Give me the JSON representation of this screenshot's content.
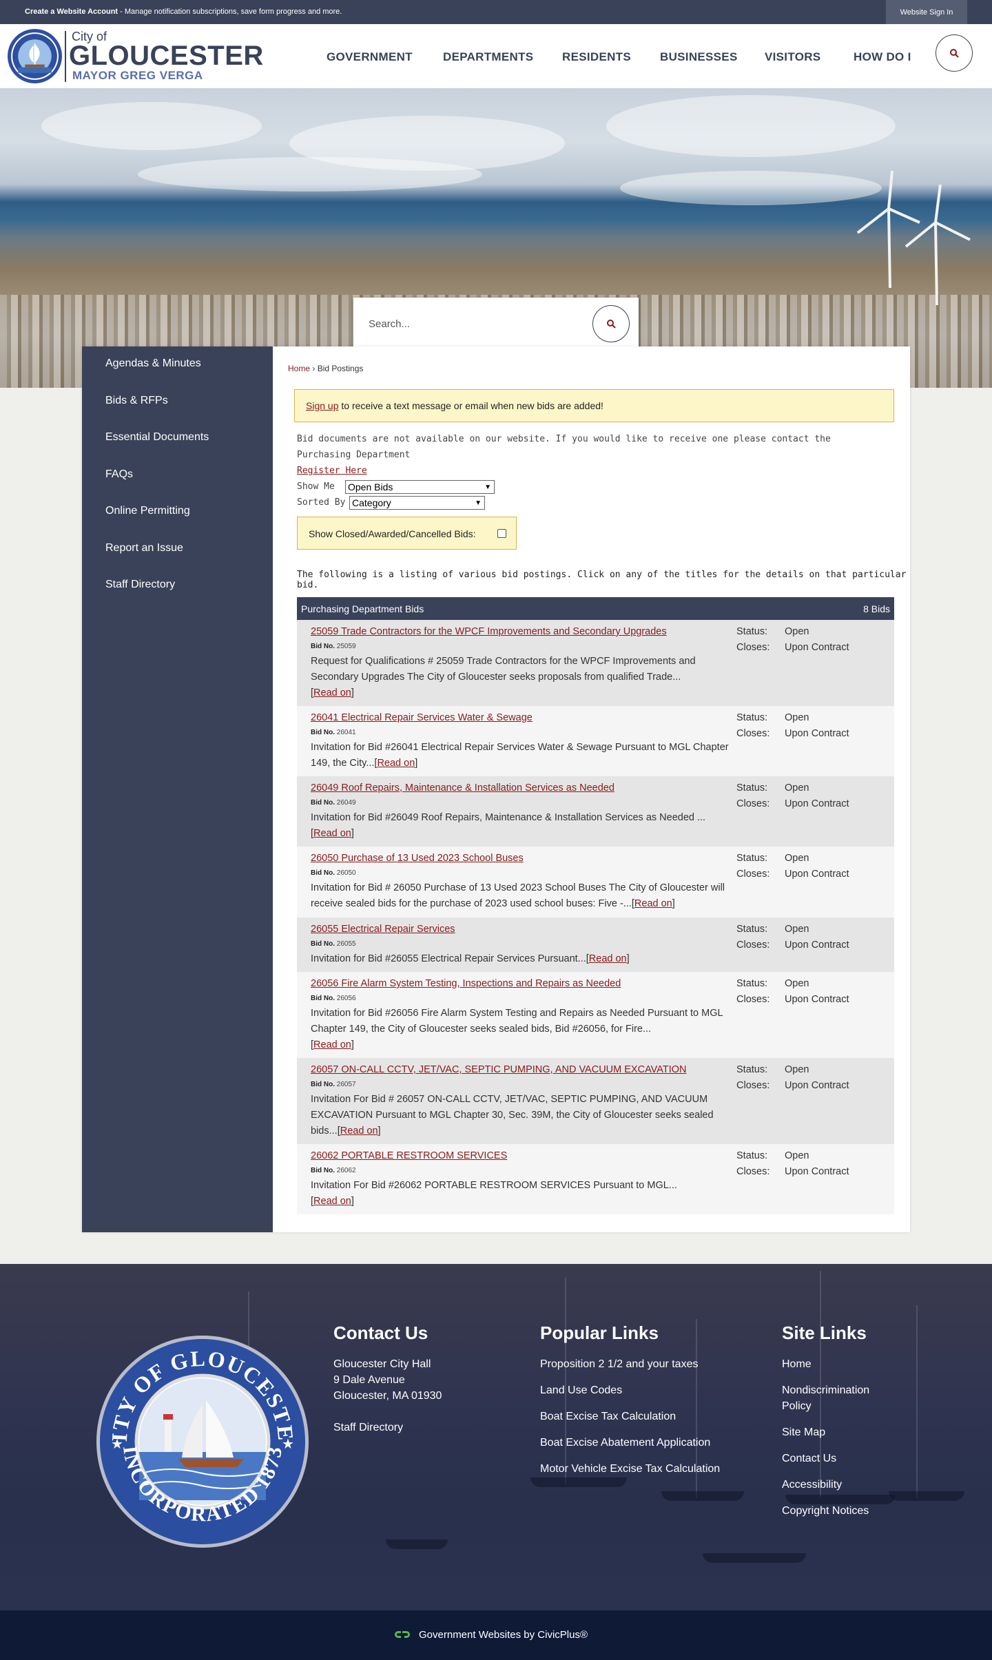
{
  "topbar": {
    "account_link": "Create a Website Account",
    "account_text": " - Manage notification subscriptions, save form progress and more.",
    "signin": "Website Sign In"
  },
  "header": {
    "city_of": "City of",
    "city_name": "GLOUCESTER",
    "mayor": "MAYOR GREG VERGA",
    "nav": [
      "GOVERNMENT",
      "DEPARTMENTS",
      "RESIDENTS",
      "BUSINESSES",
      "VISITORS",
      "HOW DO I"
    ],
    "search_icon": "search-icon"
  },
  "hero": {
    "search_placeholder": "Search..."
  },
  "sidebar": {
    "items": [
      "Agendas & Minutes",
      "Bids & RFPs",
      "Essential Documents",
      "FAQs",
      "Online Permitting",
      "Report an Issue",
      "Staff Directory"
    ]
  },
  "breadcrumb": {
    "home": "Home",
    "sep": " › ",
    "current": "Bid Postings"
  },
  "alert": {
    "link": "Sign up",
    "text": " to receive a text message or email when new bids are added!"
  },
  "notice": {
    "text": "Bid documents are not available on our website. If you would like to receive one please contact the Purchasing Department",
    "link": "Register Here"
  },
  "filters": {
    "show_me_label": "Show Me",
    "show_me_value": "Open Bids",
    "sorted_by_label": "Sorted By",
    "sorted_by_value": "Category",
    "closed_label": "Show Closed/Awarded/Cancelled Bids:"
  },
  "intro": "The following is a listing of various bid postings. Click on any of the titles for the details on that particular bid.",
  "table": {
    "title": "Purchasing Department Bids",
    "count": "8 Bids",
    "status_label": "Status:",
    "closes_label": "Closes:",
    "bid_no_label": "Bid No.",
    "read_on": "Read on",
    "rows": [
      {
        "title": "25059 Trade Contractors for the WPCF Improvements and Secondary Upgrades",
        "bid_no": "25059",
        "desc": "Request for Qualifications # 25059 Trade Contractors for the WPCF Improvements and Secondary Upgrades The City of Gloucester seeks proposals from qualified Trade...",
        "status": "Open",
        "closes": "Upon Contract"
      },
      {
        "title": "26041 Electrical Repair Services Water & Sewage",
        "bid_no": "26041",
        "desc": "Invitation for Bid #26041 Electrical Repair Services Water & Sewage Pursuant to MGL Chapter 149, the City...",
        "status": "Open",
        "closes": "Upon Contract"
      },
      {
        "title": "26049 Roof Repairs, Maintenance & Installation Services as Needed",
        "bid_no": "26049",
        "desc": "Invitation for Bid #26049 Roof Repairs, Maintenance & Installation Services as Needed ...",
        "status": "Open",
        "closes": "Upon Contract"
      },
      {
        "title": "26050 Purchase of 13 Used 2023 School Buses",
        "bid_no": "26050",
        "desc": "Invitation for Bid # 26050 Purchase of 13 Used 2023 School Buses The City of Gloucester will receive sealed bids for the purchase of 2023 used school buses: Five -...",
        "status": "Open",
        "closes": "Upon Contract"
      },
      {
        "title": "26055 Electrical Repair Services",
        "bid_no": "26055",
        "desc": "Invitation for Bid #26055 Electrical Repair Services Pursuant...",
        "status": "Open",
        "closes": "Upon Contract"
      },
      {
        "title": "26056 Fire Alarm System Testing, Inspections and Repairs as Needed",
        "bid_no": "26056",
        "desc": "Invitation for Bid #26056 Fire Alarm System Testing and Repairs as Needed Pursuant to MGL Chapter 149, the City of Gloucester seeks sealed bids, Bid #26056, for Fire...",
        "status": "Open",
        "closes": "Upon Contract"
      },
      {
        "title": "26057 ON-CALL CCTV, JET/VAC, SEPTIC PUMPING, AND VACUUM EXCAVATION",
        "bid_no": "26057",
        "desc": "Invitation For Bid # 26057 ON-CALL CCTV, JET/VAC, SEPTIC PUMPING, AND VACUUM EXCAVATION Pursuant to MGL Chapter 30, Sec. 39M, the City of Gloucester seeks sealed bids...",
        "status": "Open",
        "closes": "Upon Contract"
      },
      {
        "title": "26062 PORTABLE RESTROOM SERVICES",
        "bid_no": "26062",
        "desc": "Invitation For Bid #26062 PORTABLE RESTROOM SERVICES Pursuant to MGL...",
        "status": "Open",
        "closes": "Upon Contract"
      }
    ]
  },
  "footer": {
    "seal_top_text": "CITY OF GLOUCESTER",
    "seal_bottom_text": "INCORPORATED 1873",
    "contact_heading": "Contact Us",
    "contact_lines": [
      "Gloucester City Hall",
      "9 Dale Avenue",
      "Gloucester, MA 01930"
    ],
    "staff_directory": "Staff Directory",
    "popular_heading": "Popular Links",
    "popular_links": [
      "Proposition 2 1/2 and your taxes",
      "Land Use Codes",
      "Boat Excise Tax Calculation",
      "Boat Excise Abatement Application",
      "Motor Vehicle Excise Tax Calculation"
    ],
    "site_heading": "Site Links",
    "site_links": [
      "Home",
      "Nondiscrimination",
      "Policy",
      "Site Map",
      "Contact Us",
      "Accessibility",
      "Copyright Notices"
    ],
    "civicplus": "Government Websites by CivicPlus®"
  },
  "colors": {
    "navy": "#3a4259",
    "link": "#8a1a1a",
    "alert_bg": "#fdf6c8",
    "footer_bottom": "#0f1a36"
  }
}
